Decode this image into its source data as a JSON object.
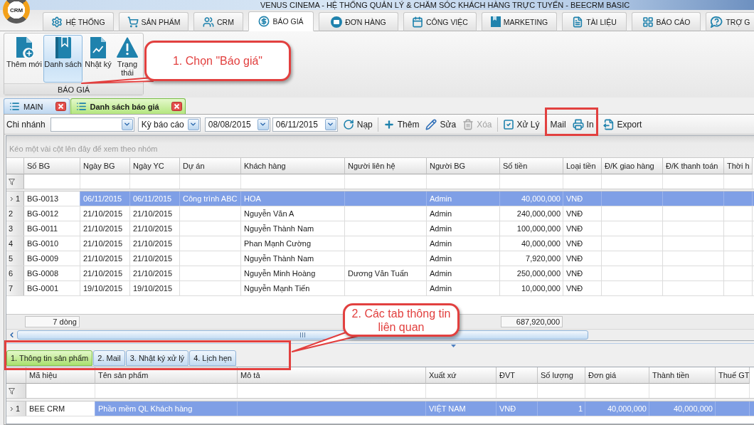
{
  "window": {
    "title": "VENUS CINEMA - HỆ THỐNG QUẢN LÝ & CHĂM SÓC KHÁCH HÀNG TRỰC TUYẾN - BEECRM BASIC"
  },
  "logo": {
    "text": "CRM"
  },
  "main_tabs": [
    {
      "label": "HỆ THỐNG",
      "selected": false
    },
    {
      "label": "SẢN PHẨM",
      "selected": false
    },
    {
      "label": "CRM",
      "selected": false
    },
    {
      "label": "BÁO GIÁ",
      "selected": true
    },
    {
      "label": "ĐƠN HÀNG",
      "selected": false
    },
    {
      "label": "CÔNG VIỆC",
      "selected": false
    },
    {
      "label": "MARKETING",
      "selected": false
    },
    {
      "label": "TÀI LIỆU",
      "selected": false
    },
    {
      "label": "BÁO CÁO",
      "selected": false
    },
    {
      "label": "TRỢ G",
      "selected": false
    }
  ],
  "ribbon": {
    "buttons": [
      {
        "label": "Thêm mới",
        "selected": false
      },
      {
        "label": "Danh sách",
        "selected": true
      },
      {
        "label": "Nhật ký",
        "selected": false
      },
      {
        "label": "Trạng thái",
        "selected": false
      }
    ],
    "group_label": "BÁO GIÁ"
  },
  "document_tabs": [
    {
      "label": "MAIN",
      "selected": false
    },
    {
      "label": "Danh sách báo giá",
      "selected": true
    }
  ],
  "toolbar": {
    "branch_label": "Chi nhánh",
    "period": "Kỳ báo cáo",
    "date_from": "08/08/2015",
    "date_to": "06/11/2015",
    "actions": [
      {
        "label": "Nạp",
        "disabled": false
      },
      {
        "label": "Thêm",
        "disabled": false
      },
      {
        "label": "Sửa",
        "disabled": false
      },
      {
        "label": "Xóa",
        "disabled": true
      },
      {
        "label": "Xử Lý",
        "disabled": false
      },
      {
        "label": "Mail",
        "disabled": false
      },
      {
        "label": "In",
        "disabled": false
      },
      {
        "label": "Export",
        "disabled": false
      }
    ]
  },
  "group_panel": {
    "hint": "Kéo một vài cột lên đây để xem theo nhóm"
  },
  "quotes_table": {
    "columns": [
      "Số BG",
      "Ngày BG",
      "Ngày YC",
      "Dự án",
      "Khách hàng",
      "Người liên hệ",
      "Người BG",
      "Số tiền",
      "Loại tiền",
      "Đ/K giao hàng",
      "Đ/K thanh toán",
      "Thời h"
    ],
    "rows": [
      {
        "number": "1",
        "selected": true,
        "quote_no": "BG-0013",
        "quote_date": "06/11/2015",
        "request_date": "06/11/2015",
        "project": "Công trình ABC",
        "customer": "HOA",
        "quoted_by": "Admin",
        "amount": "40,000,000",
        "currency": "VNĐ"
      },
      {
        "number": "2",
        "selected": false,
        "quote_no": "BG-0012",
        "quote_date": "21/10/2015",
        "request_date": "21/10/2015",
        "customer": "Nguyễn Văn A",
        "quoted_by": "Admin",
        "amount": "240,000,000",
        "currency": "VNĐ"
      },
      {
        "number": "3",
        "selected": false,
        "quote_no": "BG-0011",
        "quote_date": "21/10/2015",
        "request_date": "21/10/2015",
        "customer": "Nguyễn Thành Nam",
        "quoted_by": "Admin",
        "amount": "100,000,000",
        "currency": "VNĐ"
      },
      {
        "number": "4",
        "selected": false,
        "quote_no": "BG-0010",
        "quote_date": "21/10/2015",
        "request_date": "21/10/2015",
        "customer": "Phan Mạnh Cường",
        "quoted_by": "Admin",
        "amount": "40,000,000",
        "currency": "VNĐ"
      },
      {
        "number": "5",
        "selected": false,
        "quote_no": "BG-0009",
        "quote_date": "21/10/2015",
        "request_date": "21/10/2015",
        "customer": "Nguyễn Thành Nam",
        "quoted_by": "Admin",
        "amount": "7,920,000",
        "currency": "VNĐ"
      },
      {
        "number": "6",
        "selected": false,
        "quote_no": "BG-0008",
        "quote_date": "21/10/2015",
        "request_date": "21/10/2015",
        "customer": "Nguyễn Minh Hoàng",
        "contact": "Dương Văn Tuấn",
        "quoted_by": "Admin",
        "amount": "250,000,000",
        "currency": "VNĐ"
      },
      {
        "number": "7",
        "selected": false,
        "quote_no": "BG-0001",
        "quote_date": "19/10/2015",
        "request_date": "19/10/2015",
        "customer": "Nguyễn Mạnh Tiến",
        "quoted_by": "Admin",
        "amount": "10,000,000",
        "currency": "VNĐ"
      }
    ],
    "footer": {
      "count": "7 dòng",
      "total": "687,920,000"
    }
  },
  "detail_tabs": [
    {
      "label": "1. Thông tin sản phẩm",
      "selected": true
    },
    {
      "label": "2. Mail",
      "selected": false
    },
    {
      "label": "3. Nhật ký xử lý",
      "selected": false
    },
    {
      "label": "4. Lịch hẹn",
      "selected": false
    }
  ],
  "products_table": {
    "columns": [
      "Mã hiệu",
      "Tên sản phẩm",
      "Mô tả",
      "Xuất xứ",
      "ĐVT",
      "Số lượng",
      "Đơn giá",
      "Thành tiền",
      "Thuế GT"
    ],
    "rows": [
      {
        "number": "1",
        "selected": true,
        "code": "BEE CRM",
        "name": "Phần mềm QL Khách hàng",
        "origin": "VIỆT NAM",
        "unit": "VNĐ",
        "quantity": "1",
        "unit_price": "40,000,000",
        "total": "40,000,000"
      }
    ]
  },
  "annotations": [
    {
      "text": "1. Chọn \"Báo giá\""
    },
    {
      "text": "2. Các tab thông tin liên quan"
    }
  ]
}
